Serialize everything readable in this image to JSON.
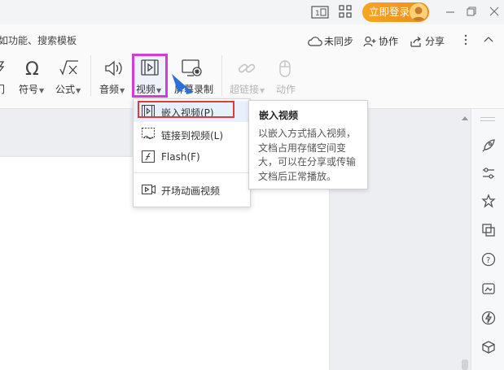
{
  "titlebar": {
    "login_label": "立即登录"
  },
  "ribbon": {
    "feature_hint": "如功能、搜索模板",
    "sync_label": "未同步",
    "collab_label": "协作",
    "share_label": "分享",
    "tools": {
      "symbol": "符号",
      "formula": "公式",
      "audio": "音频",
      "video": "视频",
      "screen_record": "屏幕录制",
      "hyperlink": "超链接",
      "action": "动作"
    }
  },
  "video_menu": {
    "items": [
      {
        "label": "嵌入视频(P)",
        "icon": "embed-video-icon"
      },
      {
        "label": "链接到视频(L)",
        "icon": "link-video-icon"
      },
      {
        "label": "Flash(F)",
        "icon": "flash-icon"
      },
      {
        "label": "开场动画视频",
        "icon": "intro-video-icon"
      }
    ]
  },
  "tooltip": {
    "title": "嵌入视频",
    "body": "以嵌入方式插入视频，文档占用存储空间变大，可以在分享或传输文档后正常播放。"
  },
  "colors": {
    "accent_orange": "#f39c12",
    "highlight_magenta": "#d63bd6",
    "highlight_red": "#e53935",
    "arrow_blue": "#2c6fd6"
  }
}
